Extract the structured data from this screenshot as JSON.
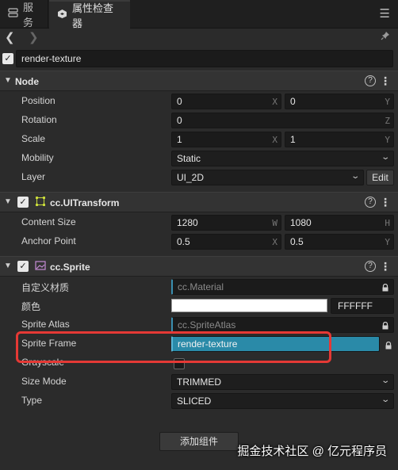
{
  "tabs": [
    {
      "label": "服务",
      "icon": "server-icon"
    },
    {
      "label": "属性检查器",
      "icon": "inspector-icon"
    }
  ],
  "node_name": "render-texture",
  "node": {
    "title": "Node",
    "position": {
      "label": "Position",
      "x": "0",
      "y": "0"
    },
    "rotation": {
      "label": "Rotation",
      "z": "0"
    },
    "scale": {
      "label": "Scale",
      "x": "1",
      "y": "1"
    },
    "mobility": {
      "label": "Mobility",
      "value": "Static"
    },
    "layer": {
      "label": "Layer",
      "value": "UI_2D",
      "edit_label": "Edit"
    }
  },
  "uitransform": {
    "title": "cc.UITransform",
    "content_size": {
      "label": "Content Size",
      "w": "1280",
      "h": "1080"
    },
    "anchor_point": {
      "label": "Anchor Point",
      "x": "0.5",
      "y": "0.5"
    }
  },
  "sprite": {
    "title": "cc.Sprite",
    "custom_material": {
      "label": "自定义材质",
      "value": "cc.Material"
    },
    "color": {
      "label": "颜色",
      "hex": "FFFFFF",
      "swatch": "#FFFFFF"
    },
    "sprite_atlas": {
      "label": "Sprite Atlas",
      "value": "cc.SpriteAtlas"
    },
    "sprite_frame": {
      "label": "Sprite Frame",
      "value": "render-texture"
    },
    "grayscale": {
      "label": "Grayscale",
      "checked": false
    },
    "size_mode": {
      "label": "Size Mode",
      "value": "TRIMMED"
    },
    "type": {
      "label": "Type",
      "value": "SLICED"
    }
  },
  "axis": {
    "x": "X",
    "y": "Y",
    "z": "Z",
    "w": "W",
    "h": "H"
  },
  "add_component_label": "添加组件",
  "watermark": "掘金技术社区 @ 亿元程序员",
  "colors": {
    "accent": "#2A8AA8",
    "highlight": "#E53935",
    "background": "#2B2B2B"
  }
}
